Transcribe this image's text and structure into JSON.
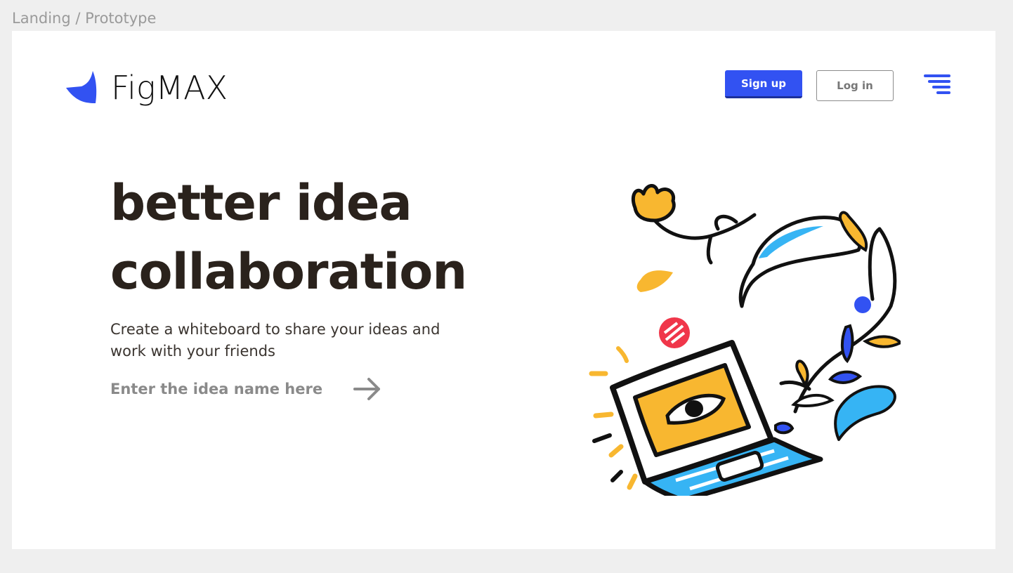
{
  "canvas": {
    "frame_label": "Landing / Prototype"
  },
  "header": {
    "logo_text": "FigMAX",
    "signup_label": "Sign up",
    "login_label": "Log in",
    "menu_icon": "menu-icon"
  },
  "hero": {
    "title_line1": "better idea",
    "title_line2": "collaboration",
    "subtitle": "Create a whiteboard to share your ideas and work with your friends",
    "input_placeholder": "Enter the idea name here",
    "submit_icon": "arrow-right-icon"
  },
  "colors": {
    "brand_blue": "#3252f2",
    "accent_yellow": "#f8b730",
    "accent_cyan": "#36b4f4",
    "stop_red": "#f0364a",
    "text_dark": "#2a221c"
  }
}
